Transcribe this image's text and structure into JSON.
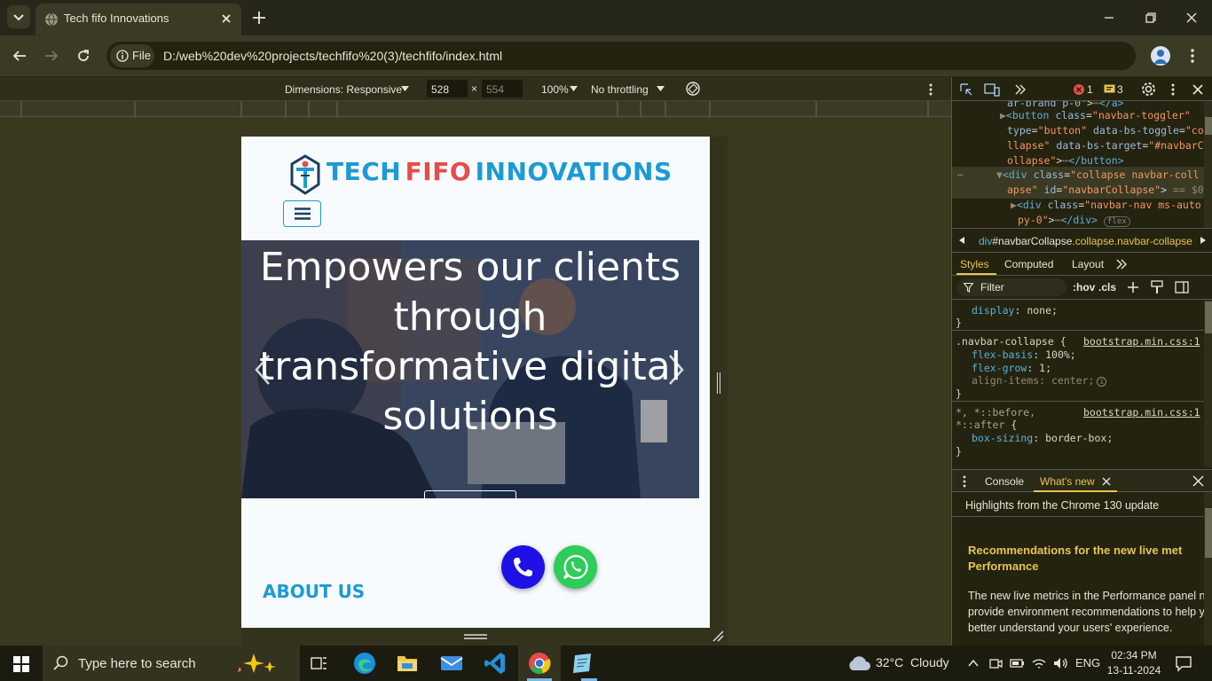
{
  "browser": {
    "tab_title": "Tech fifo Innovations",
    "file_label": "File",
    "url": "D:/web%20dev%20projects/techfifo%20(3)/techfifo/index.html"
  },
  "device_toolbar": {
    "dimensions_label": "Dimensions: Responsive",
    "width": "528",
    "height": "554",
    "zoom": "100%",
    "throttling": "No throttling"
  },
  "page": {
    "brand": {
      "word1": "TECH",
      "word2": "FIFO",
      "word3": "INNOVATIONS"
    },
    "hero_lines": [
      "Empowers our clients",
      "through",
      "transformative digital",
      "solutions"
    ],
    "about_title": "ABOUT US"
  },
  "devtools": {
    "errors": "1",
    "warnings": "3",
    "breadcrumb": {
      "tag": "div",
      "id": "#navbarCollapse",
      "classes": ".collapse.navbar-collapse"
    },
    "panel_tabs": [
      "Styles",
      "Computed",
      "Layout"
    ],
    "filter_placeholder": "Filter",
    "hov": ":hov",
    "cls": ".cls",
    "drawer_tabs": [
      "Console",
      "What's new"
    ],
    "whatsnew_header": "Highlights from the Chrome 130 update",
    "whatsnew_title": "Recommendations for the new live metrics Performance",
    "whatsnew_title_1": "Recommendations for the new live met",
    "whatsnew_title_2": "Performance",
    "whatsnew_body_1": "The new live metrics in the Performance panel no",
    "whatsnew_body_2": "provide environment recommendations to help y",
    "whatsnew_body_3": "better understand your users' experience.",
    "source_file": "bootstrap.min.css:1"
  },
  "taskbar": {
    "search_placeholder": "Type here to search",
    "weather": "32°C  Cloudy",
    "language": "ENG",
    "time": "02:34 PM",
    "date": "13-11-2024"
  },
  "colors": {
    "brand_blue": "#1c9ad6",
    "brand_red": "#e84b4b",
    "accent": "#e8c452"
  }
}
